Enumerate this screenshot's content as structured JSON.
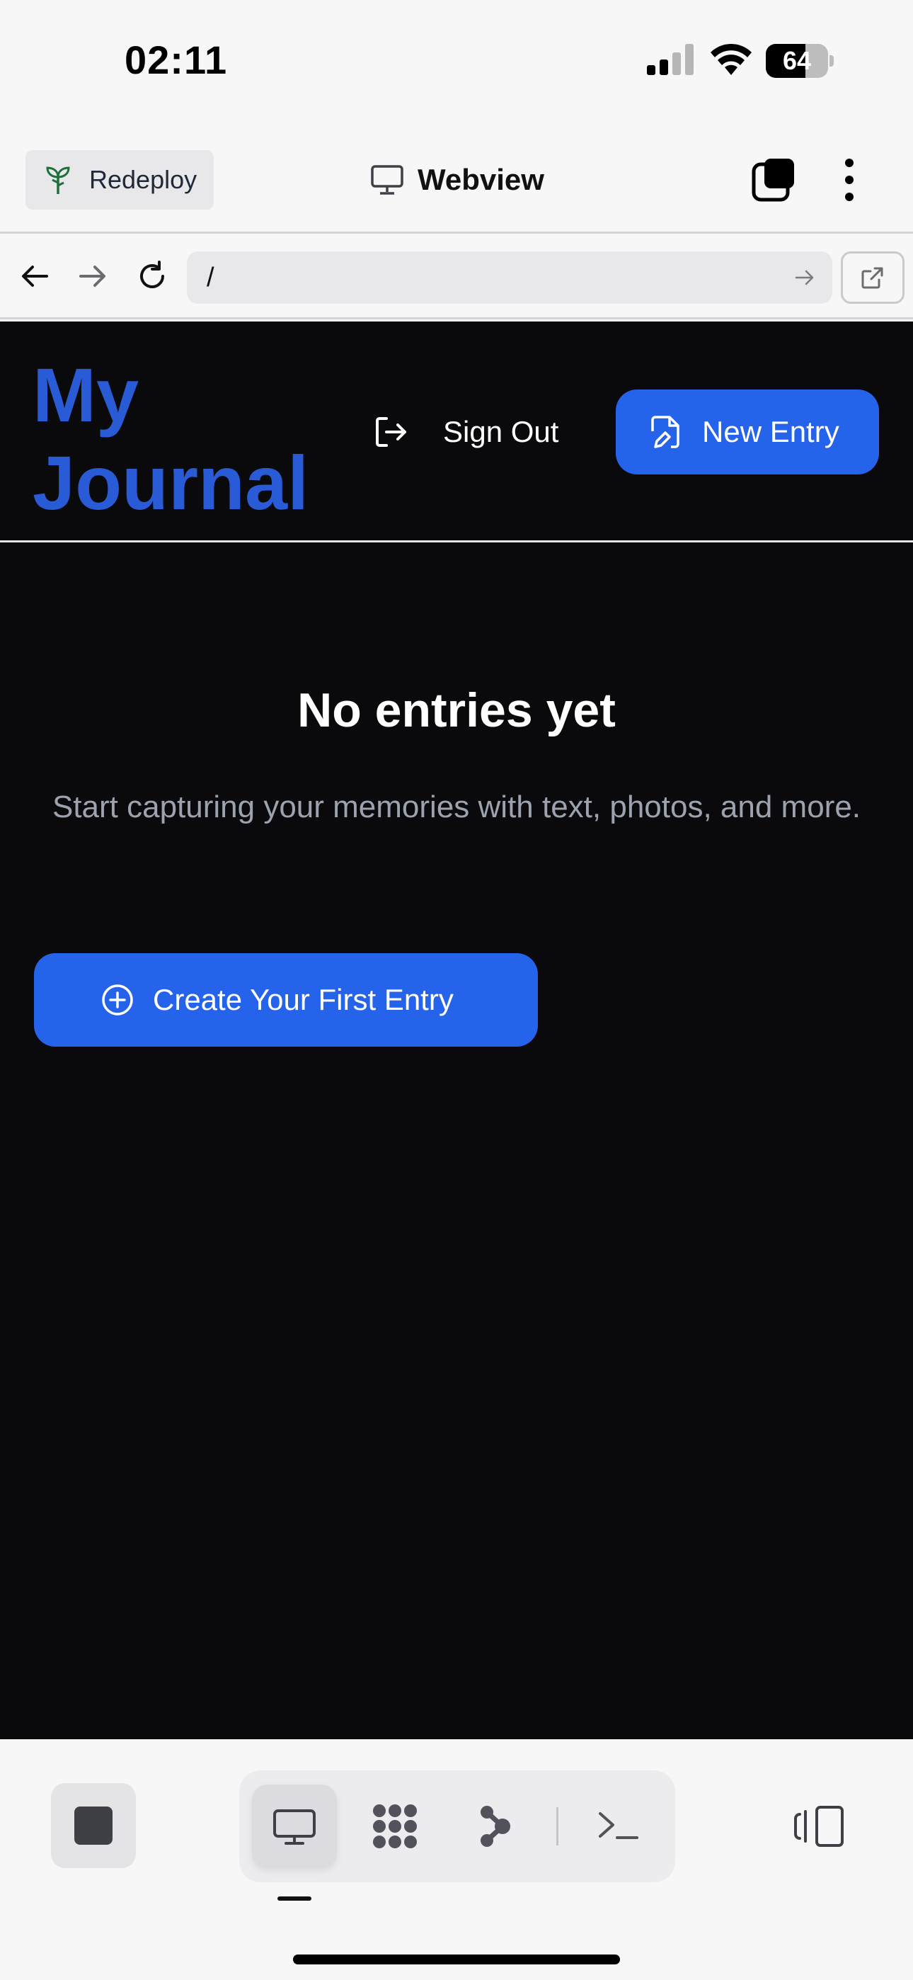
{
  "status_bar": {
    "time": "02:11",
    "battery_percent": "64",
    "battery_level": 0.64
  },
  "toolbar": {
    "redeploy_label": "Redeploy",
    "title": "Webview"
  },
  "url_bar": {
    "url": "/"
  },
  "app": {
    "title": "My Journal",
    "sign_out_label": "Sign Out",
    "new_entry_label": "New Entry",
    "empty_state": {
      "title": "No entries yet",
      "description": "Start capturing your memories with text, photos, and more.",
      "cta_label": "Create Your First Entry"
    }
  },
  "colors": {
    "accent_blue": "#2563eb",
    "title_blue": "#2a5bd7",
    "app_background": "#0a0a0c",
    "chrome_background": "#f7f7f8"
  },
  "icons": {
    "redeploy": "sprout-icon",
    "webview": "monitor-icon",
    "tabs": "tabs-icon",
    "more": "more-vertical-icon",
    "back": "arrow-left-icon",
    "forward": "arrow-right-icon",
    "reload": "reload-icon",
    "go": "arrow-right-small-icon",
    "external": "external-link-icon",
    "sign_out": "log-out-icon",
    "new_entry": "file-edit-icon",
    "create": "plus-circle-icon",
    "stop": "stop-icon",
    "webview_tab": "monitor-icon",
    "workflow_tab": "nodes-icon",
    "git_tab": "branch-icon",
    "shell_tab": "terminal-icon",
    "layout": "layout-icon"
  }
}
